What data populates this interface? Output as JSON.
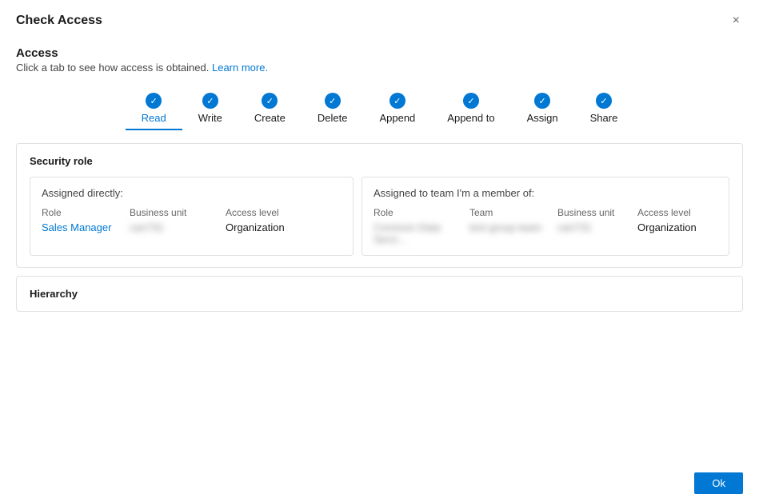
{
  "dialog": {
    "title": "Check Access",
    "close_label": "×"
  },
  "access_section": {
    "title": "Access",
    "subtitle": "Click a tab to see how access is obtained.",
    "learn_more": "Learn more."
  },
  "tabs": [
    {
      "label": "Read",
      "active": true
    },
    {
      "label": "Write",
      "active": false
    },
    {
      "label": "Create",
      "active": false
    },
    {
      "label": "Delete",
      "active": false
    },
    {
      "label": "Append",
      "active": false
    },
    {
      "label": "Append to",
      "active": false
    },
    {
      "label": "Assign",
      "active": false
    },
    {
      "label": "Share",
      "active": false
    }
  ],
  "security_role": {
    "title": "Security role",
    "assigned_directly": {
      "label": "Assigned directly:",
      "columns": [
        "Role",
        "Business unit",
        "Access level"
      ],
      "rows": [
        {
          "role_prefix": "Sales",
          "role_suffix": " Manager",
          "business_unit": "can731",
          "access_level": "Organization"
        }
      ]
    },
    "assigned_to_team": {
      "label": "Assigned to team I'm a member of:",
      "columns": [
        "Role",
        "Team",
        "Business unit",
        "Access level"
      ],
      "rows": [
        {
          "role": "Common Data Servi...",
          "team": "test group team",
          "business_unit": "can731",
          "access_level": "Organization"
        }
      ]
    }
  },
  "hierarchy": {
    "title": "Hierarchy"
  },
  "footer": {
    "ok_label": "Ok"
  }
}
